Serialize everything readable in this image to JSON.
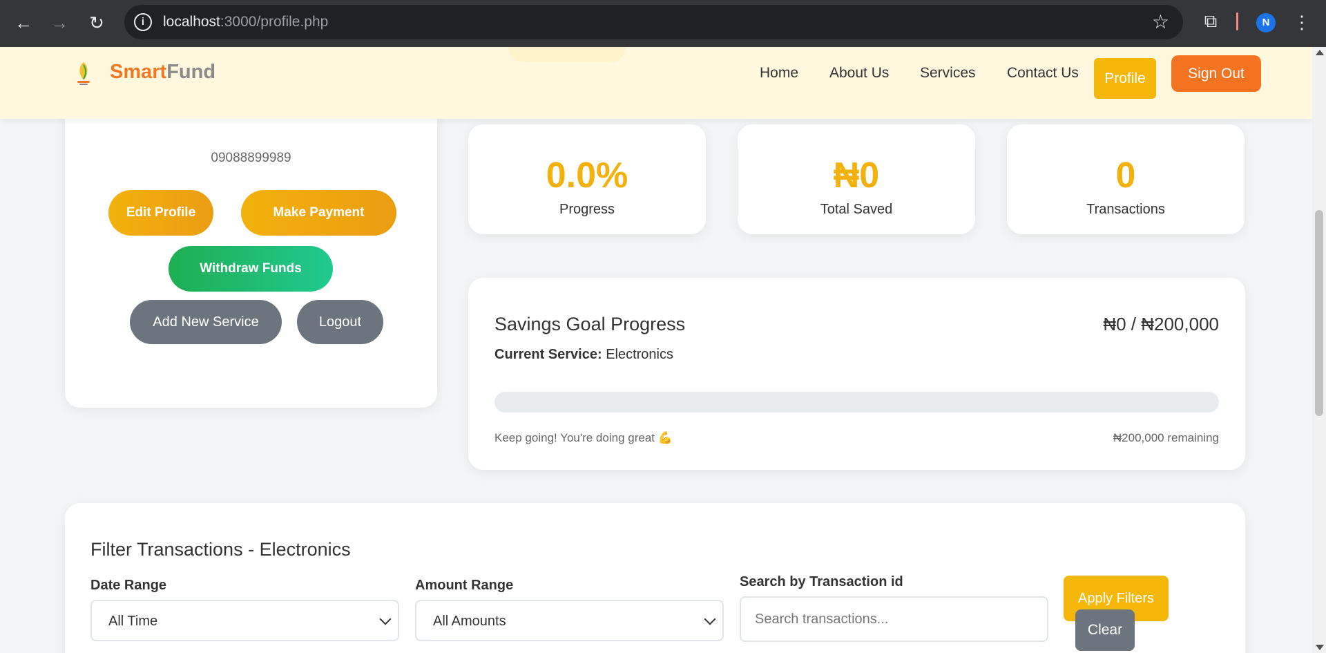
{
  "browser": {
    "url_host": "localhost",
    "url_path": ":3000/profile.php",
    "profile_initial": "N"
  },
  "header": {
    "brand_part1": "Smart",
    "brand_part2": "Fund",
    "nav": [
      "Home",
      "About Us",
      "Services",
      "Contact Us"
    ],
    "profile_label": "Profile",
    "signout_label": "Sign Out"
  },
  "profile": {
    "phone": "09088899989",
    "edit_label": "Edit Profile",
    "payment_label": "Make Payment",
    "withdraw_label": "Withdraw Funds",
    "add_service_label": "Add New Service",
    "logout_label": "Logout"
  },
  "stats": [
    {
      "value": "0.0%",
      "label": "Progress"
    },
    {
      "value": "₦0",
      "label": "Total Saved"
    },
    {
      "value": "0",
      "label": "Transactions"
    }
  ],
  "goal": {
    "title": "Savings Goal Progress",
    "amount": "₦0 / ₦200,000",
    "service_label": "Current Service:",
    "service_value": "Electronics",
    "progress_fraction": 0.0,
    "message": "Keep going! You're doing great 💪",
    "remaining": "₦200,000 remaining"
  },
  "filters": {
    "title": "Filter Transactions - Electronics",
    "date_label": "Date Range",
    "date_value": "All Time",
    "amount_label": "Amount Range",
    "amount_value": "All Amounts",
    "search_label": "Search by Transaction id",
    "search_placeholder": "Search transactions...",
    "apply_label": "Apply Filters",
    "clear_label": "Clear"
  },
  "colors": {
    "accent_yellow": "#f5b70a",
    "accent_orange": "#f47320",
    "green": "#1fae53",
    "gray_button": "#6c757d",
    "header_bg": "#fff8df"
  }
}
